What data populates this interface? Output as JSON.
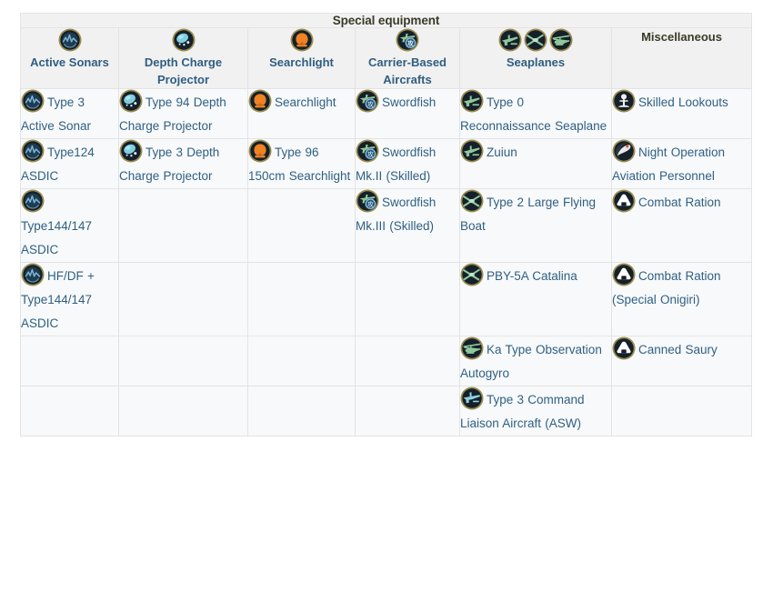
{
  "table": {
    "title": "Special equipment",
    "columns": [
      {
        "id": "active-sonars",
        "label": "Active Sonars",
        "is_link": true,
        "icons": [
          "sonar-icon"
        ]
      },
      {
        "id": "depth-charge-projector",
        "label": "Depth Charge Projector",
        "is_link": true,
        "icons": [
          "depth-charge-icon"
        ]
      },
      {
        "id": "searchlight",
        "label": "Searchlight",
        "is_link": true,
        "icons": [
          "searchlight-icon"
        ]
      },
      {
        "id": "carrier-based-aircrafts",
        "label": "Carrier-Based Aircrafts",
        "is_link": true,
        "icons": [
          "carrier-plane-icon"
        ]
      },
      {
        "id": "seaplanes",
        "label": "Seaplanes",
        "is_link": true,
        "icons": [
          "seaplane-icon",
          "flyingboat-icon",
          "autogyro-icon"
        ]
      },
      {
        "id": "miscellaneous",
        "label": "Miscellaneous",
        "is_link": false,
        "icons": []
      }
    ],
    "rows": [
      [
        {
          "icon": "sonar-icon",
          "label": "Type 3 Active Sonar"
        },
        {
          "icon": "depth-charge-icon",
          "label": "Type 94 Depth Charge Projector"
        },
        {
          "icon": "searchlight-icon",
          "label": "Searchlight"
        },
        {
          "icon": "carrier-plane-icon",
          "label": "Swordfish"
        },
        {
          "icon": "seaplane-icon",
          "label": "Type 0 Reconnaissance Seaplane"
        },
        {
          "icon": "lookout-icon",
          "label": "Skilled Lookouts"
        }
      ],
      [
        {
          "icon": "sonar-icon",
          "label": "Type124 ASDIC"
        },
        {
          "icon": "depth-charge-icon",
          "label": "Type 3 Depth Charge Projector"
        },
        {
          "icon": "searchlight-icon",
          "label": "Type 96 150cm Searchlight"
        },
        {
          "icon": "carrier-plane-icon",
          "label": "Swordfish Mk.II (Skilled)"
        },
        {
          "icon": "seaplane-icon",
          "label": "Zuiun"
        },
        {
          "icon": "night-aviation-icon",
          "label": "Night Operation Aviation Personnel"
        }
      ],
      [
        {
          "icon": "sonar-icon",
          "label": "Type144/147 ASDIC"
        },
        null,
        null,
        {
          "icon": "carrier-plane-icon",
          "label": "Swordfish Mk.III (Skilled)"
        },
        {
          "icon": "flyingboat-icon",
          "label": "Type 2 Large Flying Boat"
        },
        {
          "icon": "ration-icon",
          "label": "Combat Ration"
        }
      ],
      [
        {
          "icon": "sonar-icon",
          "label": "HF/DF + Type144/147 ASDIC"
        },
        null,
        null,
        null,
        {
          "icon": "flyingboat-icon",
          "label": "PBY-5A Catalina"
        },
        {
          "icon": "ration-icon",
          "label": "Combat Ration (Special Onigiri)"
        }
      ],
      [
        null,
        null,
        null,
        null,
        {
          "icon": "autogyro-icon",
          "label": "Ka Type Observation Autogyro"
        },
        {
          "icon": "ration-icon",
          "label": "Canned Saury"
        }
      ],
      [
        null,
        null,
        null,
        null,
        {
          "icon": "liaison-plane-icon",
          "label": "Type 3 Command Liaison Aircraft (ASW)"
        },
        null
      ]
    ]
  },
  "colors": {
    "link": "#2f6084",
    "header_link": "#2f5e82",
    "title_text": "#3a3a28",
    "header_bg": "#f1f1f1",
    "cell_bg": "#f8f9fa",
    "border": "#e3e3e3",
    "icon_rim": "#9a8d50",
    "icon_dark": "#15202b",
    "sonar_blue": "#7fb4d4",
    "depth_charge_blue": "#7fcfe0",
    "searchlight_orange": "#ef8222",
    "plane_green": "#8fc99a",
    "plane_blue": "#8fd0e0",
    "ration_white": "#ffffff"
  }
}
